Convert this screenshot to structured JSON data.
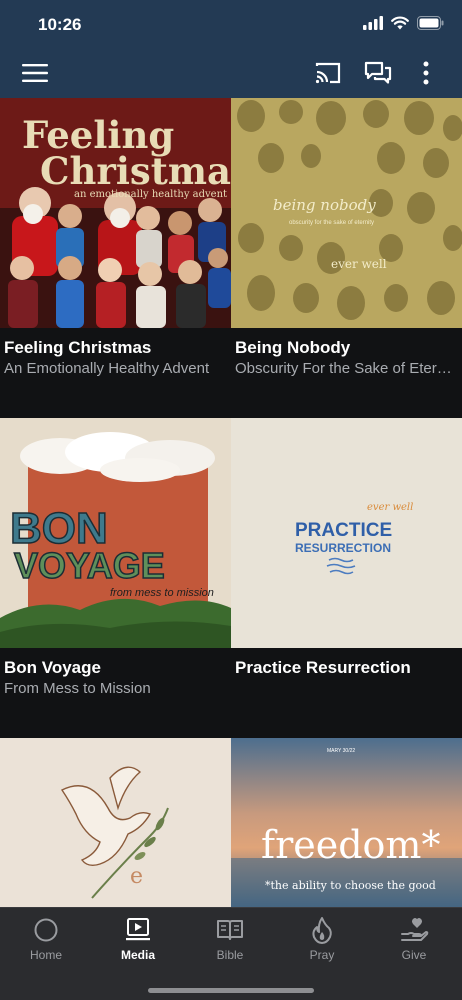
{
  "status_bar": {
    "time": "10:26"
  },
  "app_bar": {
    "icons": [
      "menu-icon",
      "cast-icon",
      "chat-icon",
      "more-vertical-icon"
    ]
  },
  "media_items": [
    {
      "title": "Feeling Christmas",
      "subtitle": "An Emotionally Healthy Advent",
      "art_text": {
        "line1": "Feeling",
        "line2": "Christmas",
        "tagline": "an emotionally healthy advent"
      }
    },
    {
      "title": "Being Nobody",
      "subtitle": "Obscurity For the Sake of Eternity",
      "art_text": {
        "script": "being nobody",
        "small": "obscurity for the sake of eternity",
        "brand": "ever well"
      }
    },
    {
      "title": "Bon Voyage",
      "subtitle": "From Mess to Mission",
      "art_text": {
        "line1": "BON",
        "line2": "VOYAGE",
        "tagline": "from mess to mission"
      }
    },
    {
      "title": "Practice Resurrection",
      "subtitle": "",
      "art_text": {
        "brand": "ever well",
        "line1": "PRACTICE",
        "line2": "RESURRECTION"
      }
    },
    {
      "title": "",
      "subtitle": "",
      "art_text": {
        "mark": "e"
      }
    },
    {
      "title": "",
      "subtitle": "",
      "art_text": {
        "date": "MARY 30/22",
        "word": "freedom*",
        "tagline": "*the ability to choose the good"
      }
    }
  ],
  "tab_bar": {
    "tabs": [
      {
        "label": "Home",
        "icon": "home-circle-icon"
      },
      {
        "label": "Media",
        "icon": "media-play-icon"
      },
      {
        "label": "Bible",
        "icon": "bible-book-icon"
      },
      {
        "label": "Pray",
        "icon": "flame-icon"
      },
      {
        "label": "Give",
        "icon": "give-hand-heart-icon"
      }
    ],
    "active": "Media"
  },
  "colors": {
    "header": "#233a54",
    "background": "#111214",
    "tab_bar": "#2b2c2f",
    "active_tab": "#ffffff",
    "inactive_tab": "#9a9ca0"
  }
}
